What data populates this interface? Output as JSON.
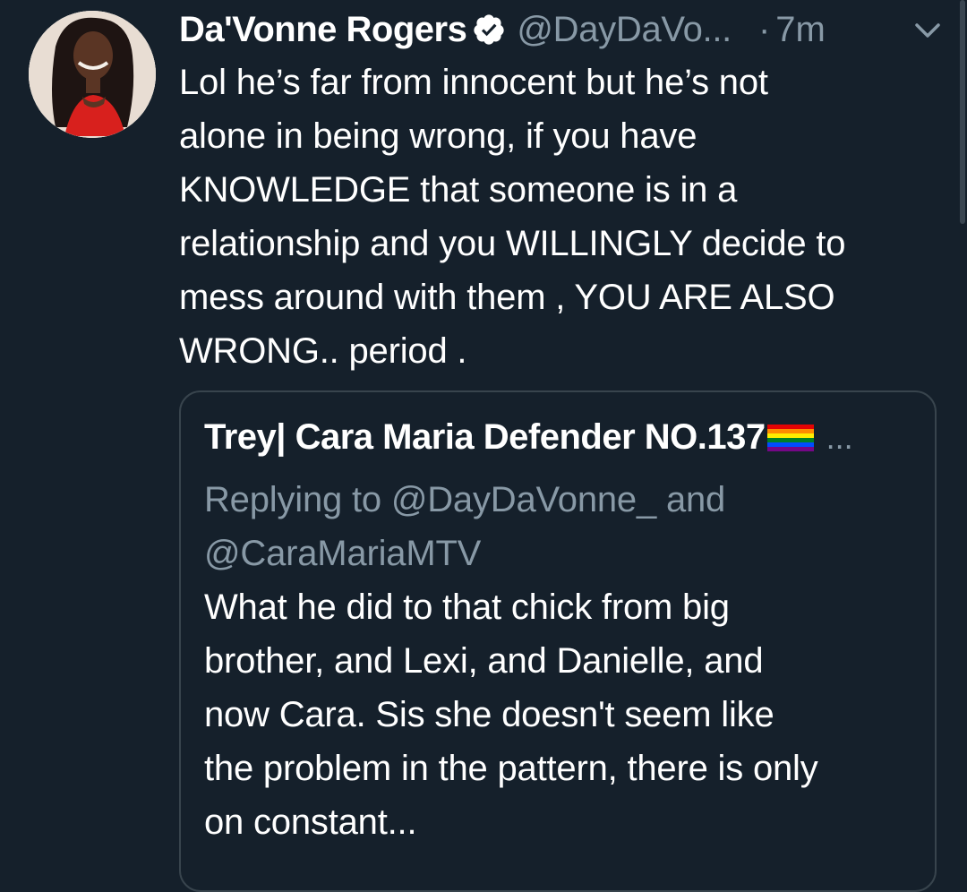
{
  "tweet": {
    "display_name": "Da'Vonne Rogers",
    "handle": "@DayDaVo...",
    "separator": "·",
    "time": "7m",
    "text": "Lol he’s far from innocent but he’s not\nalone in being wrong, if you have\nKNOWLEDGE that someone is in a\nrelationship and you WILLINGLY decide to\nmess around with them , YOU ARE ALSO\nWRONG.. period ."
  },
  "quote": {
    "display_name": "Trey| Cara Maria Defender NO.137",
    "more": "...",
    "replying_prefix": "Replying to ",
    "reply_to_1": "@DayDaVonne_",
    "reply_join": " and",
    "reply_to_2": "@CaraMariaMTV",
    "text": "What he did to that chick from big\nbrother, and Lexi, and Danielle, and\nnow Cara. Sis she doesn't seem like\nthe problem in the pattern, there is only\non constant..."
  },
  "icons": {
    "verified": "verified-badge-icon",
    "menu": "chevron-down-icon",
    "flag": "rainbow-flag-icon"
  },
  "colors": {
    "background": "#15202b",
    "text": "#ffffff",
    "secondary": "#8899a6",
    "border": "#38444d"
  }
}
